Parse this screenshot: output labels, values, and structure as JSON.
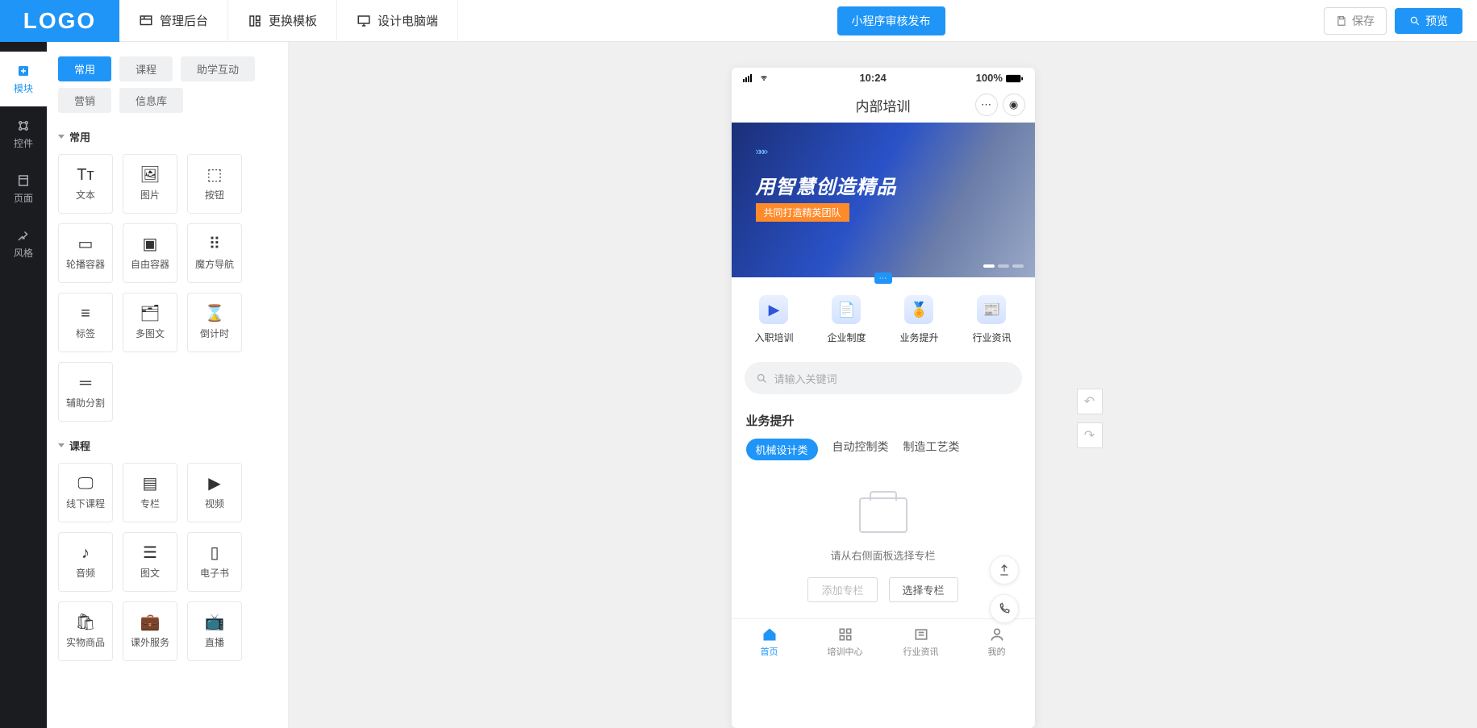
{
  "brand": {
    "logo_text": "LOGO"
  },
  "topnav": {
    "admin": "管理后台",
    "change_template": "更换模板",
    "design_pc": "设计电脑端",
    "publish_button": "小程序审核发布",
    "save": "保存",
    "preview": "预览"
  },
  "leftstrip": [
    {
      "key": "module",
      "label": "模块",
      "active": true
    },
    {
      "key": "widget",
      "label": "控件",
      "active": false
    },
    {
      "key": "page",
      "label": "页面",
      "active": false
    },
    {
      "key": "style",
      "label": "风格",
      "active": false
    }
  ],
  "categories": {
    "row1": [
      {
        "label": "常用",
        "active": true
      },
      {
        "label": "课程",
        "active": false
      },
      {
        "label": "助学互动",
        "active": false
      }
    ],
    "row2": [
      {
        "label": "营销",
        "active": false
      },
      {
        "label": "信息库",
        "active": false
      }
    ]
  },
  "sections": [
    {
      "title": "常用",
      "items": [
        {
          "label": "文本",
          "glyph": "Tᴛ"
        },
        {
          "label": "图片",
          "glyph": "🖼"
        },
        {
          "label": "按钮",
          "glyph": "⬚"
        },
        {
          "label": "轮播容器",
          "glyph": "▭"
        },
        {
          "label": "自由容器",
          "glyph": "▣"
        },
        {
          "label": "魔方导航",
          "glyph": "⠿"
        },
        {
          "label": "标签",
          "glyph": "≡"
        },
        {
          "label": "多图文",
          "glyph": "🗂"
        },
        {
          "label": "倒计时",
          "glyph": "⌛"
        },
        {
          "label": "辅助分割",
          "glyph": "═"
        }
      ]
    },
    {
      "title": "课程",
      "items": [
        {
          "label": "线下课程",
          "glyph": "🖵"
        },
        {
          "label": "专栏",
          "glyph": "▤"
        },
        {
          "label": "视频",
          "glyph": "▶"
        },
        {
          "label": "音频",
          "glyph": "♪"
        },
        {
          "label": "图文",
          "glyph": "☰"
        },
        {
          "label": "电子书",
          "glyph": "▯"
        },
        {
          "label": "实物商品",
          "glyph": "🛍"
        },
        {
          "label": "课外服务",
          "glyph": "💼"
        },
        {
          "label": "直播",
          "glyph": "📺"
        }
      ]
    }
  ],
  "phone": {
    "status": {
      "time": "10:24",
      "battery": "100%"
    },
    "title": "内部培训",
    "banner": {
      "arrows": "»»»",
      "headline": "用智慧创造精品",
      "subtag": "共同打造精英团队",
      "slide_count": 3
    },
    "quicknav": [
      {
        "label": "入职培训",
        "glyph": "▶"
      },
      {
        "label": "企业制度",
        "glyph": "📄"
      },
      {
        "label": "业务提升",
        "glyph": "🏅"
      },
      {
        "label": "行业资讯",
        "glyph": "📰"
      }
    ],
    "search_placeholder": "请输入关键词",
    "section_title": "业务提升",
    "tags": [
      {
        "label": "机械设计类",
        "active": true
      },
      {
        "label": "自动控制类",
        "active": false
      },
      {
        "label": "制造工艺类",
        "active": false
      }
    ],
    "empty_hint": "请从右侧面板选择专栏",
    "empty_actions": {
      "add": "添加专栏",
      "select": "选择专栏"
    },
    "tabbar": [
      {
        "label": "首页",
        "active": true
      },
      {
        "label": "培训中心",
        "active": false
      },
      {
        "label": "行业资讯",
        "active": false
      },
      {
        "label": "我的",
        "active": false
      }
    ]
  }
}
